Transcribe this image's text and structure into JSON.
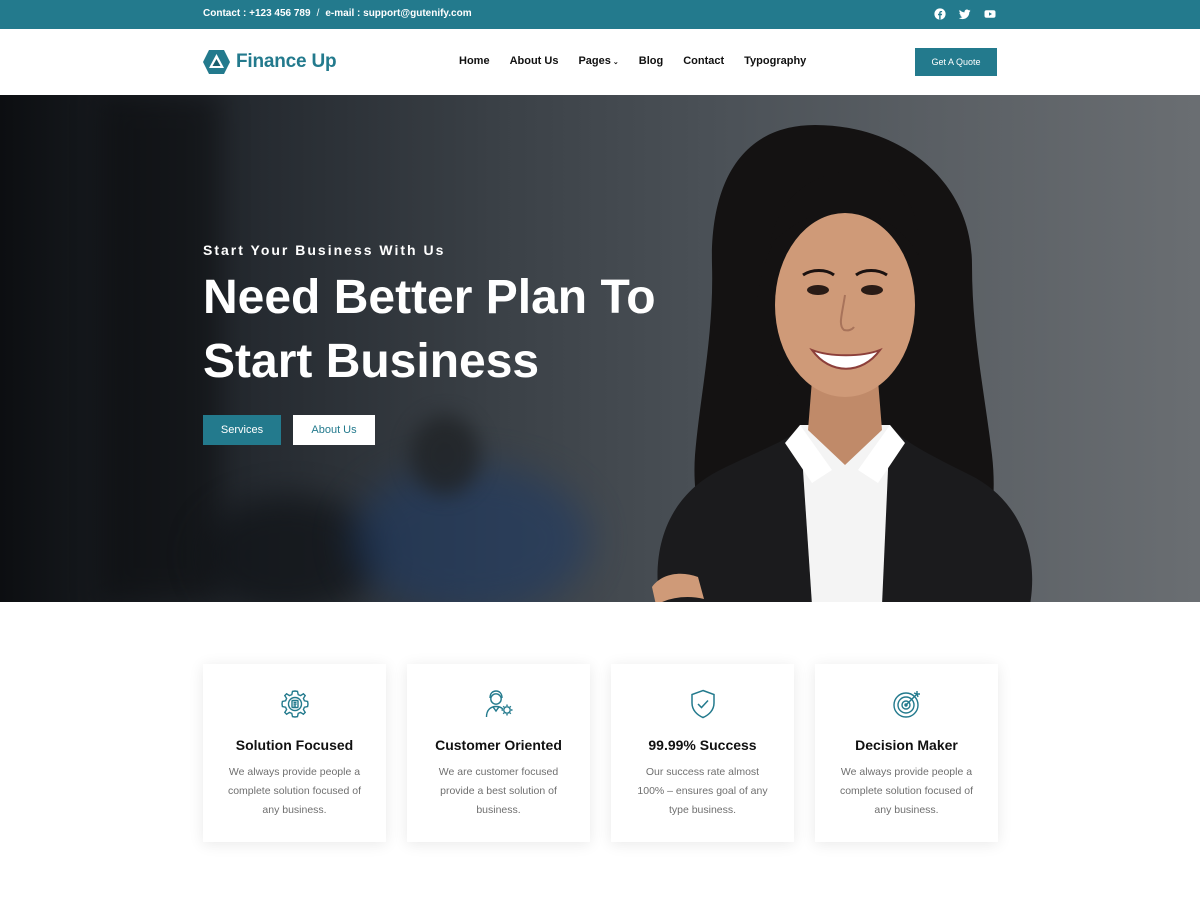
{
  "topbar": {
    "contact_text": "Contact : +123 456 789",
    "separator": "/",
    "email_text": "e-mail : support@gutenify.com",
    "social_icons": [
      "facebook-icon",
      "twitter-icon",
      "youtube-icon"
    ]
  },
  "header": {
    "logo_text": "Finance Up",
    "nav": [
      {
        "label": "Home"
      },
      {
        "label": "About Us"
      },
      {
        "label": "Pages",
        "has_dropdown": true
      },
      {
        "label": "Blog"
      },
      {
        "label": "Contact"
      },
      {
        "label": "Typography"
      }
    ],
    "cta_label": "Get A Quote"
  },
  "hero": {
    "eyebrow": "Start Your Business With Us",
    "headline": "Need Better Plan To Start Business",
    "primary_button": "Services",
    "secondary_button": "About Us"
  },
  "features": [
    {
      "icon": "gear-icon",
      "title": "Solution Focused",
      "text": "We always provide people a complete solution focused of any business."
    },
    {
      "icon": "customer-icon",
      "title": "Customer Oriented",
      "text": "We are customer focused provide a best solution of business."
    },
    {
      "icon": "shield-check-icon",
      "title": "99.99% Success",
      "text": "Our success rate almost 100% – ensures goal of any type business."
    },
    {
      "icon": "target-icon",
      "title": "Decision Maker",
      "text": "We always provide people a complete solution focused of any business."
    }
  ],
  "colors": {
    "accent": "#237a8d",
    "white": "#ffffff",
    "text_dark": "#111111",
    "text_muted": "#6f6f6f"
  }
}
